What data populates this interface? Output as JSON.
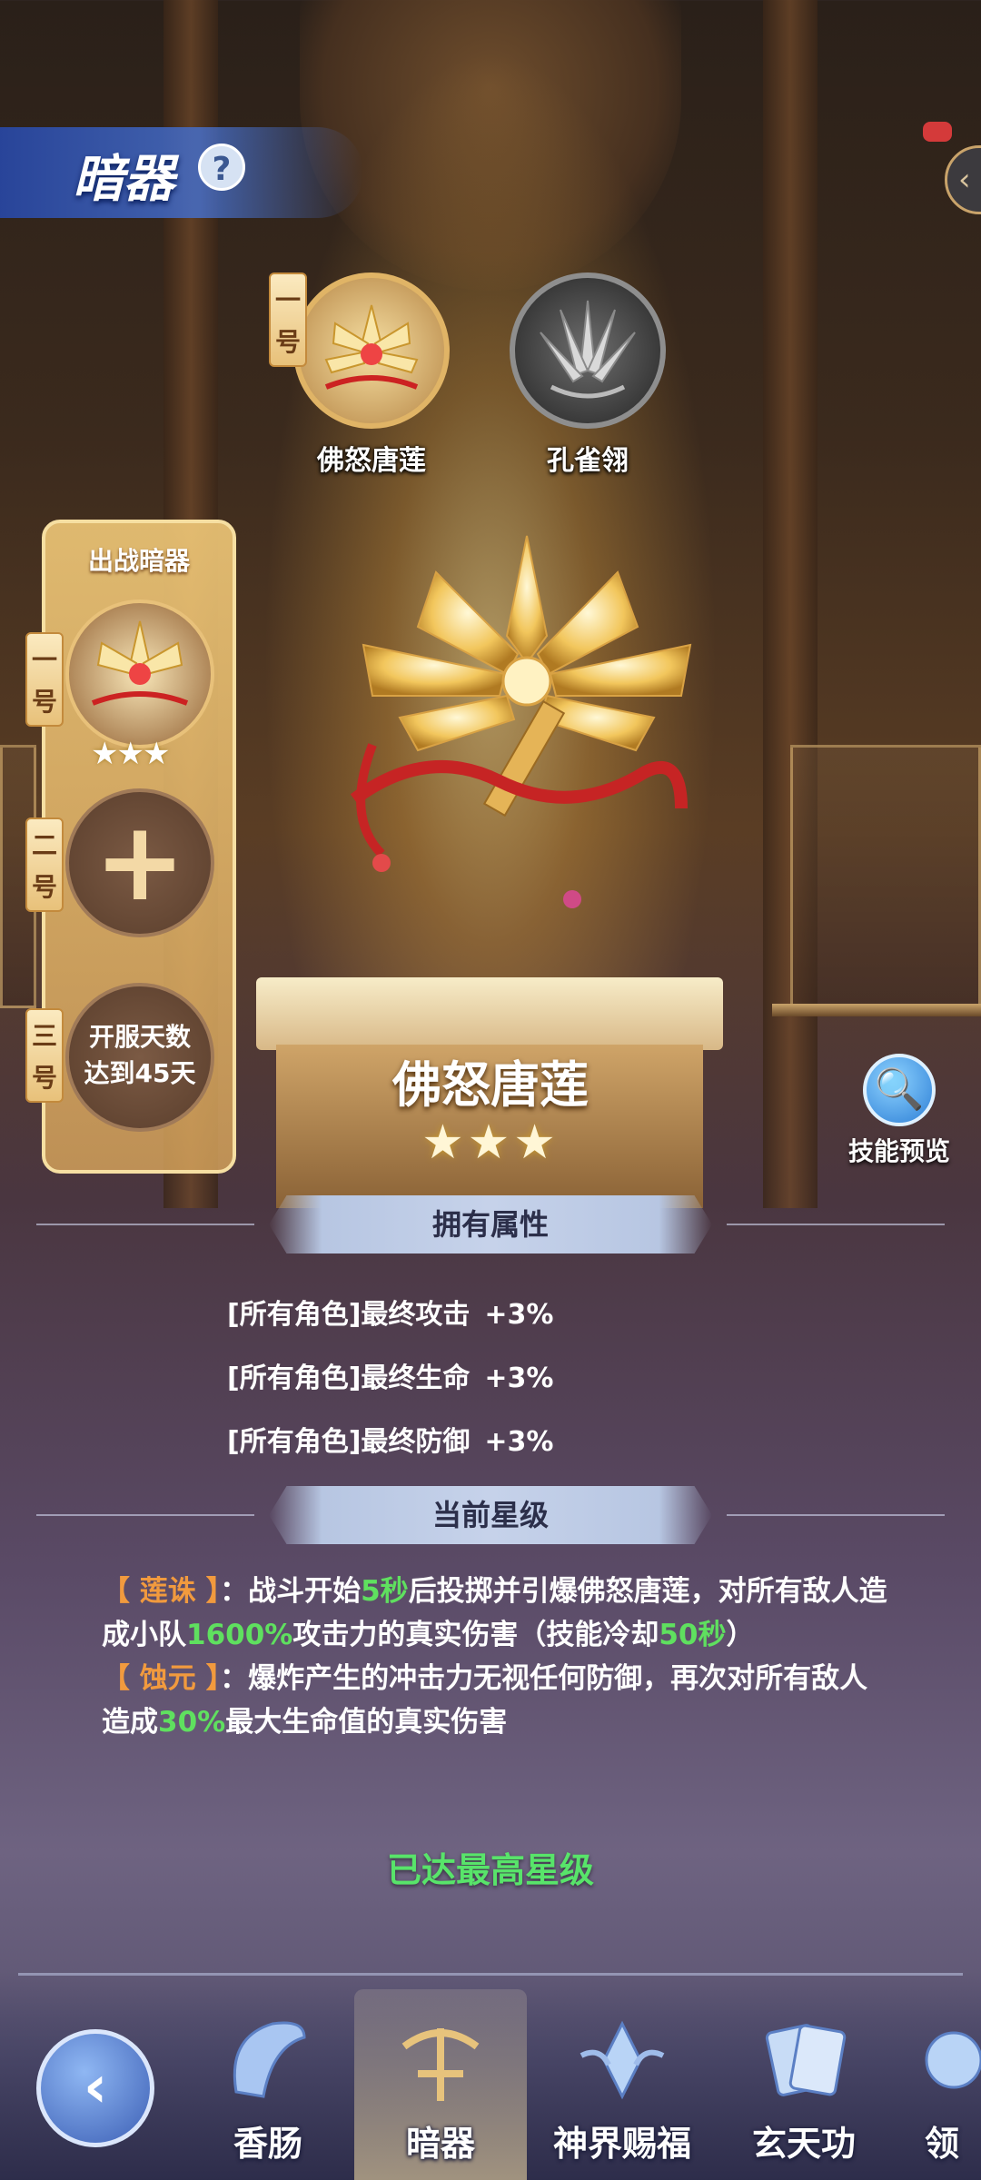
{
  "header": {
    "title": "暗器",
    "help_icon": "?",
    "expand_icon": "‹"
  },
  "weapons": [
    {
      "name": "佛怒唐莲",
      "tag": "一号",
      "state": "active"
    },
    {
      "name": "孔雀翎",
      "state": "inactive"
    }
  ],
  "battle_panel": {
    "title": "出战暗器",
    "slots": [
      {
        "tag": "一号",
        "stars": "★★★"
      },
      {
        "tag": "二号",
        "icon": "+"
      },
      {
        "tag": "三号",
        "lock_text_line1": "开服天数",
        "lock_text_line2": "达到45天"
      }
    ]
  },
  "item": {
    "name": "佛怒唐莲",
    "stars": "★★★"
  },
  "preview": {
    "label": "技能预览",
    "icon": "🔍"
  },
  "attributes": {
    "header": "拥有属性",
    "rows": [
      {
        "label": "[所有角色]最终攻击",
        "value": "+3%"
      },
      {
        "label": "[所有角色]最终生命",
        "value": "+3%"
      },
      {
        "label": "[所有角色]最终防御",
        "value": "+3%"
      }
    ]
  },
  "star_level": {
    "header": "当前星级",
    "skill1": {
      "tag": "【 莲诛 】",
      "t1": "：战斗开始",
      "h1": "5秒",
      "t2": "后投掷并引爆佛怒唐莲，对所有敌人造成小队",
      "h2": "1600%",
      "t3": "攻击力的真实伤害（技能冷却",
      "h3": "50秒",
      "t4": "）"
    },
    "skill2": {
      "tag": "【 蚀元 】",
      "t1": "：爆炸产生的冲击力无视任何防御，再次对所有敌人造成",
      "h1": "30%",
      "t2": "最大生命值的真实伤害"
    },
    "max_text": "已达最高星级"
  },
  "nav": {
    "back_icon": "‹",
    "items": [
      {
        "label": "香肠",
        "icon": "sausage-icon"
      },
      {
        "label": "暗器",
        "icon": "crossbow-icon",
        "active": true
      },
      {
        "label": "神界赐福",
        "icon": "blessing-icon"
      },
      {
        "label": "玄天功",
        "icon": "cards-icon"
      },
      {
        "label": "领"
      }
    ]
  },
  "colors": {
    "accent_gold": "#e0b466",
    "highlight_green": "#5fe05f",
    "tag_orange": "#f19a3e",
    "title_blue": "#3c5fb5"
  }
}
